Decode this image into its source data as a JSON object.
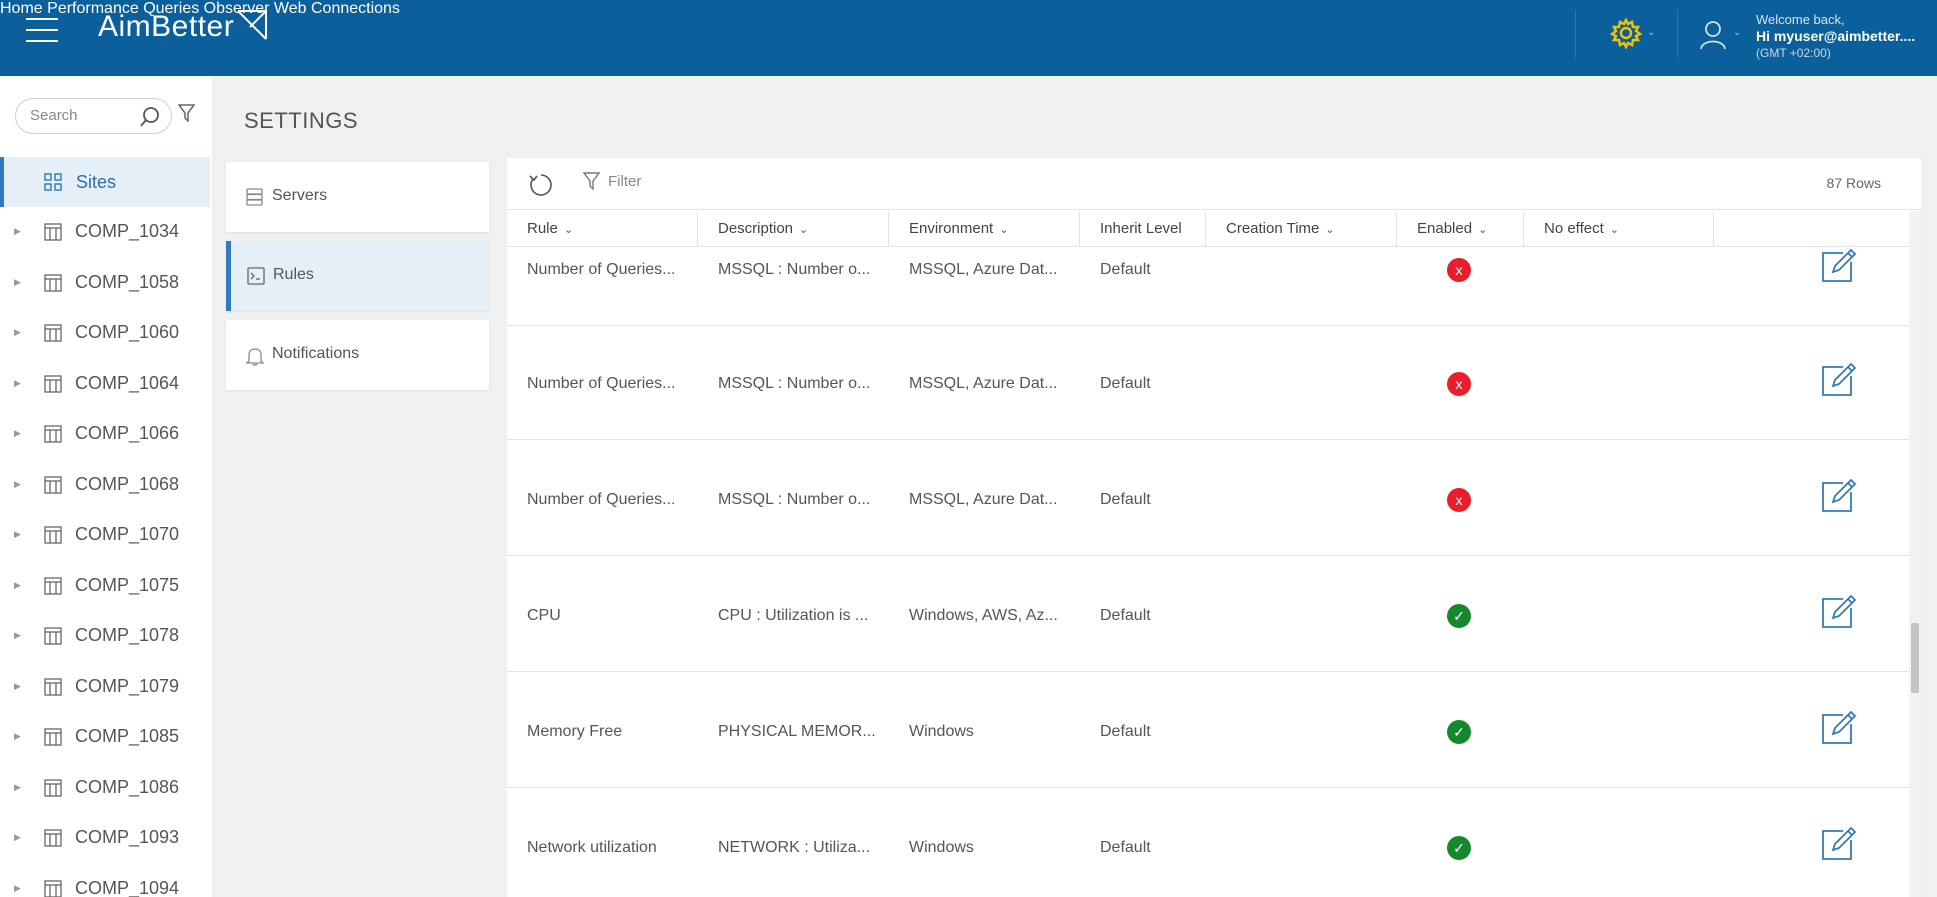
{
  "header": {
    "logo_text": "AimBetter",
    "nav": [
      "Home",
      "Performance",
      "Queries",
      "Observer",
      "Web",
      "Connections"
    ],
    "welcome_line": "Welcome back,",
    "user_line": "Hi myuser@aimbetter....",
    "timezone": "(GMT +02:00)",
    "gear_color": "#f2c200",
    "brand_color": "#0b5f9a"
  },
  "sidebar": {
    "search_placeholder": "Search",
    "sites_label": "Sites",
    "items": [
      "COMP_1034",
      "COMP_1058",
      "COMP_1060",
      "COMP_1064",
      "COMP_1066",
      "COMP_1068",
      "COMP_1070",
      "COMP_1075",
      "COMP_1078",
      "COMP_1079",
      "COMP_1085",
      "COMP_1086",
      "COMP_1093",
      "COMP_1094"
    ]
  },
  "page": {
    "title": "SETTINGS",
    "menu": [
      {
        "label": "Servers",
        "icon": "database-icon"
      },
      {
        "label": "Rules",
        "icon": "terminal-icon"
      },
      {
        "label": "Notifications",
        "icon": "bell-icon"
      }
    ]
  },
  "table": {
    "filter_label": "Filter",
    "row_count": "87 Rows",
    "columns": [
      "Rule",
      "Description",
      "Environment",
      "Inherit Level",
      "Creation Time",
      "Enabled",
      "No effect"
    ],
    "rows": [
      {
        "rule": "Number of Queries...",
        "description": "MSSQL : Number o...",
        "environment": "MSSQL, Azure Dat...",
        "inherit": "Default",
        "creation": "",
        "enabled": "x"
      },
      {
        "rule": "Number of Queries...",
        "description": "MSSQL : Number o...",
        "environment": "MSSQL, Azure Dat...",
        "inherit": "Default",
        "creation": "",
        "enabled": "x"
      },
      {
        "rule": "Number of Queries...",
        "description": "MSSQL : Number o...",
        "environment": "MSSQL, Azure Dat...",
        "inherit": "Default",
        "creation": "",
        "enabled": "x"
      },
      {
        "rule": "CPU",
        "description": "CPU : Utilization is ...",
        "environment": "Windows, AWS, Az...",
        "inherit": "Default",
        "creation": "",
        "enabled": "✓"
      },
      {
        "rule": "Memory Free",
        "description": "PHYSICAL MEMOR...",
        "environment": "Windows",
        "inherit": "Default",
        "creation": "",
        "enabled": "✓"
      },
      {
        "rule": "Network utilization",
        "description": "NETWORK : Utiliza...",
        "environment": "Windows",
        "inherit": "Default",
        "creation": "",
        "enabled": "✓"
      }
    ]
  }
}
